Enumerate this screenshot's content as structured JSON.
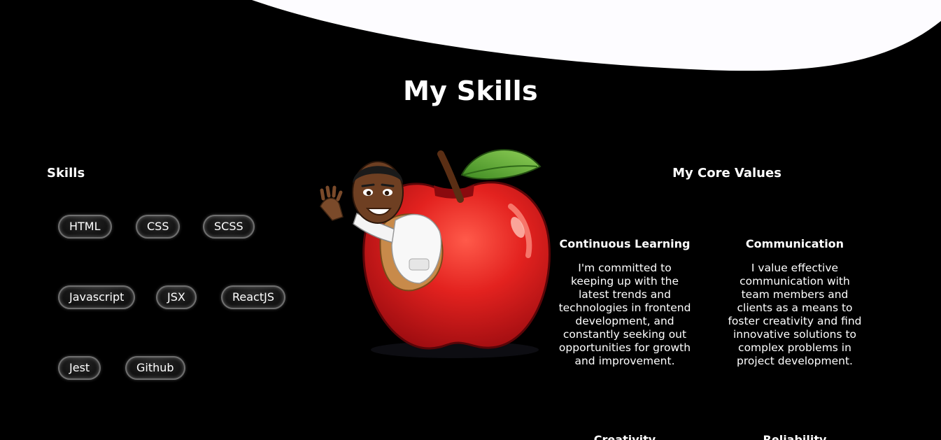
{
  "section": {
    "title": "My Skills"
  },
  "skills": {
    "heading": "Skills",
    "items": [
      "HTML",
      "CSS",
      "SCSS",
      "Javascript",
      "JSX",
      "ReactJS",
      "Jest",
      "Github"
    ]
  },
  "illustration": {
    "icon": "apple-avatar-illustration"
  },
  "core_values": {
    "heading": "My Core Values",
    "items": [
      {
        "title": "Continuous Learning",
        "text": "I'm committed to keeping up with the latest trends and technologies in frontend development, and constantly seeking out opportunities for growth and improvement."
      },
      {
        "title": "Communication",
        "text": "I value effective communication with team members and clients as a means to foster creativity and find innovative solutions to complex problems in project development."
      },
      {
        "title": "Creativity",
        "text": ""
      },
      {
        "title": "Reliability",
        "text": ""
      }
    ]
  },
  "colors": {
    "background": "#000000",
    "wave": "#fdfcff",
    "apple": "#d81c1c",
    "leaf": "#5fa833"
  }
}
